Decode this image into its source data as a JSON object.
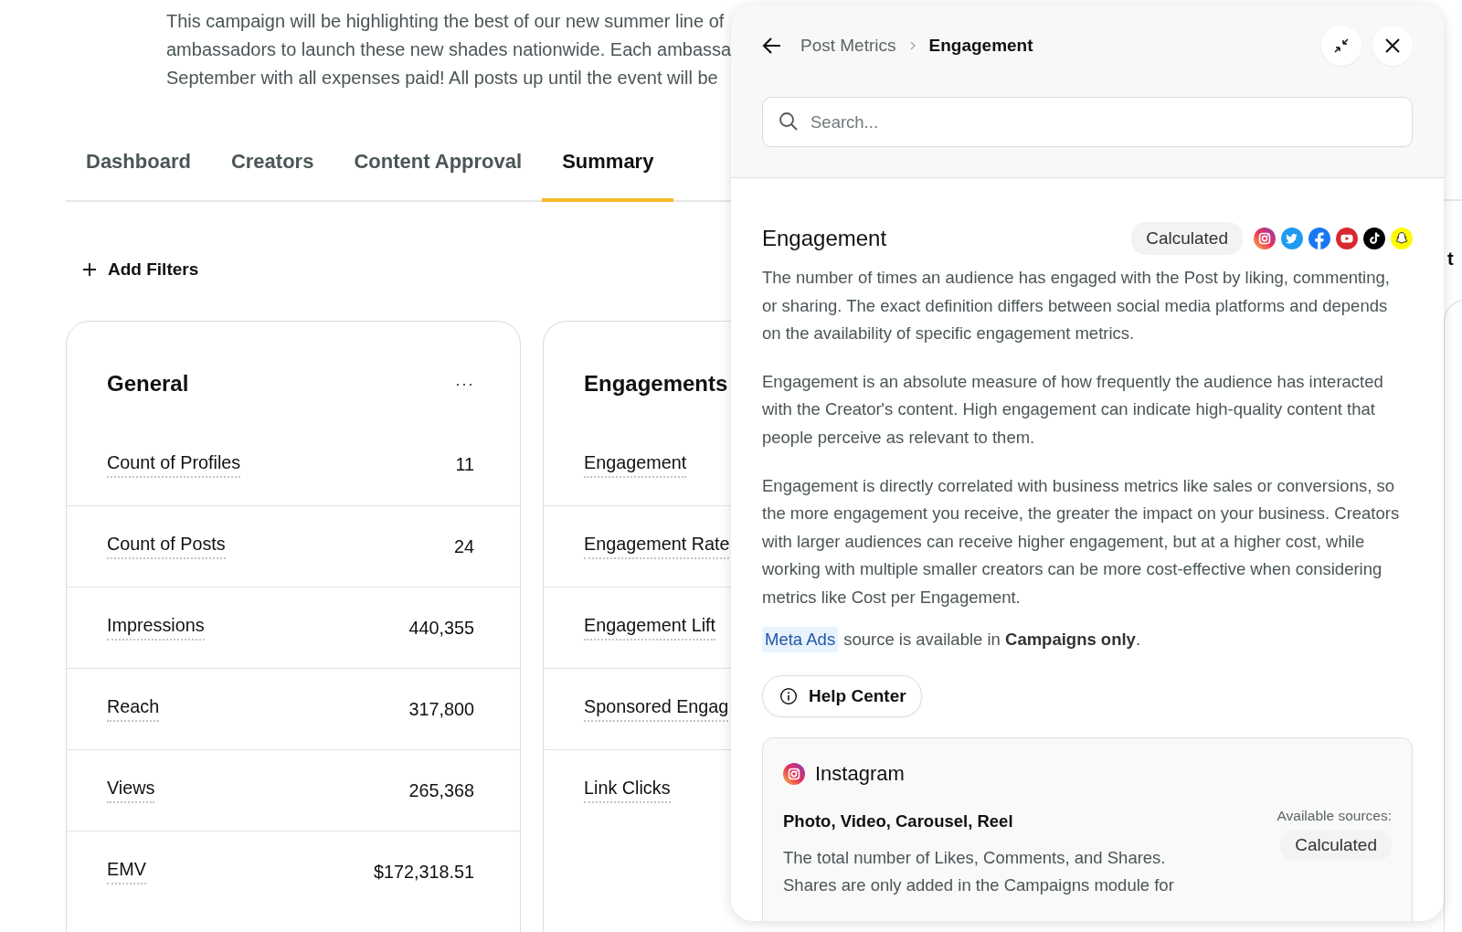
{
  "campaign_description": [
    "This campaign will be highlighting the best of our new summer line of",
    "ambassadors to launch these new shades nationwide. Each ambassa",
    "September with all expenses paid! All posts up until the event will be"
  ],
  "tabs": [
    {
      "label": "Dashboard",
      "selected": false
    },
    {
      "label": "Creators",
      "selected": false
    },
    {
      "label": "Content Approval",
      "selected": false
    },
    {
      "label": "Summary",
      "selected": true
    }
  ],
  "add_filters": "Add Filters",
  "cards": [
    {
      "title": "General",
      "menu": "···",
      "rows": [
        {
          "label": "Count of Profiles",
          "value": "11"
        },
        {
          "label": "Count of Posts",
          "value": "24"
        },
        {
          "label": "Impressions",
          "value": "440,355"
        },
        {
          "label": "Reach",
          "value": "317,800"
        },
        {
          "label": "Views",
          "value": "265,368"
        },
        {
          "label": "EMV",
          "value": "$172,318.51"
        }
      ]
    },
    {
      "title": "Engagements",
      "rows": [
        {
          "label": "Engagement"
        },
        {
          "label": "Engagement Rate"
        },
        {
          "label": "Engagement Lift"
        },
        {
          "label": "Sponsored Engag"
        },
        {
          "label": "Link Clicks"
        }
      ]
    }
  ],
  "background_fragment": "t",
  "panel": {
    "breadcrumb": [
      "Post Metrics",
      "Engagement"
    ],
    "search": {
      "placeholder": "Search..."
    },
    "metric": {
      "title": "Engagement",
      "source": "Calculated",
      "platforms": [
        {
          "kind": "instagram"
        },
        {
          "kind": "twitter"
        },
        {
          "kind": "facebook"
        },
        {
          "kind": "youtube"
        },
        {
          "kind": "tiktok"
        },
        {
          "kind": "snapchat"
        }
      ],
      "paragraphs": [
        "The number of times an audience has engaged with the Post by liking, commenting, or sharing. The exact definition differs between social media platforms and depends on the availability of specific engagement metrics.",
        "Engagement is an absolute measure of how frequently the audience has interacted with the Creator's content. High engagement can indicate high-quality content that people perceive as relevant to them.",
        "Engagement is directly correlated with business metrics like sales or conversions, so the more engagement you receive, the greater the impact on your business. Creators with larger audiences can receive higher engagement, but at a higher cost, while working with multiple smaller creators can be more cost-effective when considering metrics like Cost per Engagement."
      ],
      "source_note": {
        "tag": "Meta Ads",
        "text": "source is available in **Campaigns only**."
      },
      "help_button": "Help Center",
      "platform_card": {
        "kind": "instagram",
        "name": "Instagram",
        "content_types": "Photo, Video, Carousel, Reel",
        "sources_label": "Available sources:",
        "sources": [
          "Calculated"
        ],
        "description": "The total number of Likes, Comments, and Shares. Shares are only added in the Campaigns module for"
      }
    }
  }
}
